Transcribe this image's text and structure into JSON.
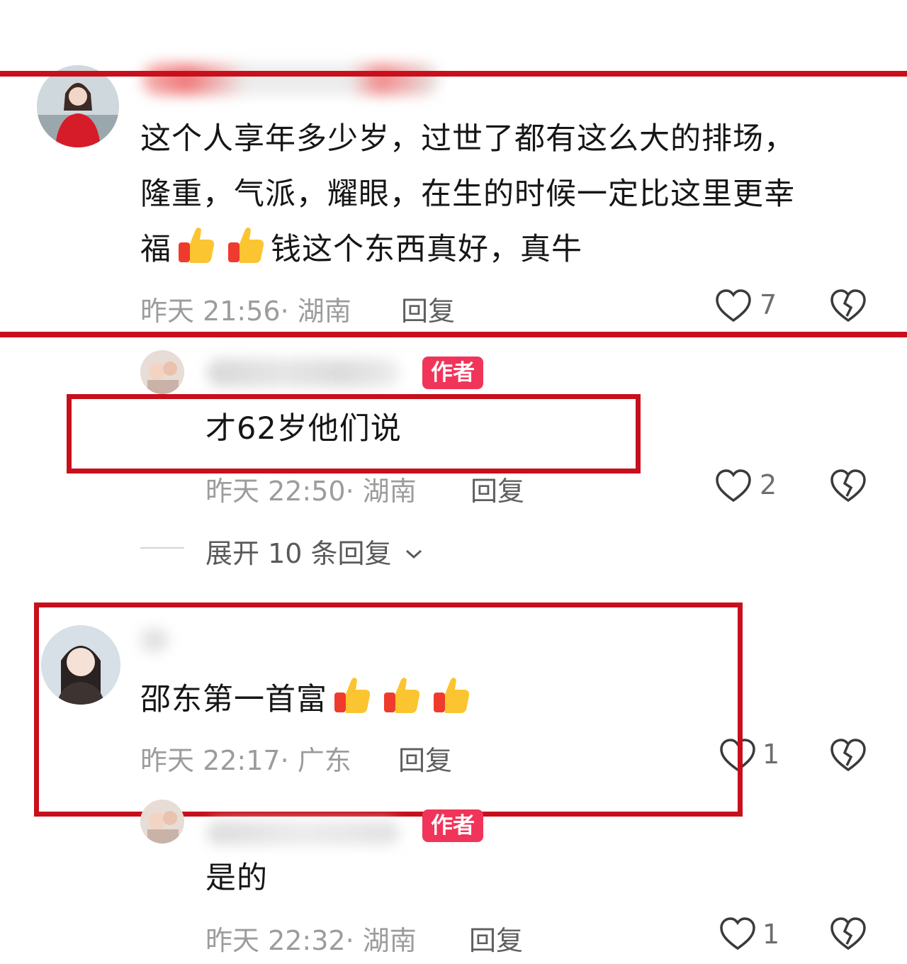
{
  "comments": [
    {
      "text_lines": [
        "这个人享年多少岁，过世了都有这么大的排场，",
        "隆重，气派，耀眼，在生的时候一定比这里更幸",
        "福"
      ],
      "text_tail": "钱这个东西真好，真牛",
      "time": "昨天 21:56",
      "location": "湖南",
      "reply_label": "回复",
      "likes": "7"
    },
    {
      "badge": "作者",
      "text": "才62岁他们说",
      "time": "昨天 22:50",
      "location": "湖南",
      "reply_label": "回复",
      "likes": "2"
    },
    {
      "text": "邵东第一首富",
      "time": "昨天 22:17",
      "location": "广东",
      "reply_label": "回复",
      "likes": "1"
    },
    {
      "badge": "作者",
      "text": "是的",
      "time": "昨天 22:32",
      "location": "湖南",
      "reply_label": "回复",
      "likes": "1"
    }
  ],
  "expand": {
    "label": "展开 10 条回复"
  },
  "colors": {
    "annotation_red": "#c8101c",
    "author_badge": "#f1345a"
  },
  "icons": [
    "heart-outline-icon",
    "broken-heart-icon",
    "thumbs-up-emoji",
    "chevron-down-icon"
  ]
}
